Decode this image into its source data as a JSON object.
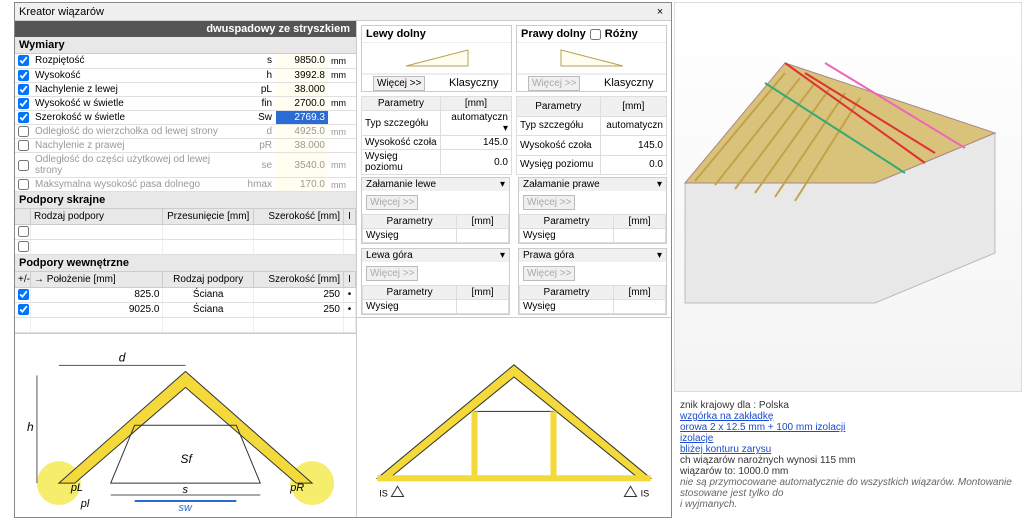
{
  "dialog": {
    "title": "Kreator wiązarów",
    "dark_header": "dwuspadowy ze stryszkiem"
  },
  "sections": {
    "wymiary": "Wymiary",
    "podpory_skrajne": "Podpory skrajne",
    "podpory_wewnetrzne": "Podpory wewnętrzne"
  },
  "params": [
    {
      "c": true,
      "label": "Rozpiętość",
      "sym": "s",
      "val": "9850.0",
      "unit": "mm",
      "sel": false
    },
    {
      "c": true,
      "label": "Wysokość",
      "sym": "h",
      "val": "3992.8",
      "unit": "mm",
      "sel": false
    },
    {
      "c": true,
      "label": "Nachylenie z lewej",
      "sym": "pL",
      "val": "38.000",
      "unit": "",
      "sel": false
    },
    {
      "c": true,
      "label": "Wysokość w świetle",
      "sym": "fin",
      "val": "2700.0",
      "unit": "mm",
      "sel": false
    },
    {
      "c": true,
      "label": "Szerokość w świetle",
      "sym": "Sw",
      "val": "2769.3",
      "unit": "",
      "sel": true
    },
    {
      "c": false,
      "label": "Odległość do wierzchołka od lewej strony",
      "sym": "d",
      "val": "4925.0",
      "unit": "mm",
      "sel": false,
      "dis": true
    },
    {
      "c": false,
      "label": "Nachylenie z prawej",
      "sym": "pR",
      "val": "38.000",
      "unit": "",
      "sel": false,
      "dis": true
    },
    {
      "c": false,
      "label": "Odległość do części użytkowej od lewej strony",
      "sym": "se",
      "val": "3540.0",
      "unit": "mm",
      "sel": false,
      "dis": true
    },
    {
      "c": false,
      "label": "Maksymalna wysokość pasa dolnego",
      "sym": "hmax",
      "val": "170.0",
      "unit": "mm",
      "sel": false,
      "dis": true
    }
  ],
  "ext_support_headers": {
    "c1": "Rodzaj podpory",
    "c2": "Przesunięcie [mm]",
    "c3": "Szerokość [mm]",
    "c4": "I"
  },
  "int_support_headers": {
    "c0": "+/-",
    "c1": "→ Położenie [mm]",
    "c2": "Rodzaj podpory",
    "c3": "Szerokość [mm]",
    "c4": "I"
  },
  "int_supports": [
    {
      "c": true,
      "pos": "825.0",
      "type": "Ściana",
      "w": "250",
      "m": "•"
    },
    {
      "c": true,
      "pos": "9025.0",
      "type": "Ściana",
      "w": "250",
      "m": "•"
    }
  ],
  "heel": {
    "left_title": "Lewy dolny",
    "right_title": "Prawy dolny",
    "rozny": "Różny",
    "more": "Więcej >>",
    "klasyczny": "Klasyczny",
    "p_param": "Parametry",
    "p_mm": "[mm]",
    "typ": "Typ szczegółu",
    "typ_val": "automatyczn",
    "wys": "Wysokość czoła",
    "wys_val": "145.0",
    "wysieg": "Wysięg poziomu",
    "wysieg_val": "0.0"
  },
  "groups": {
    "zal_l": "Załamanie lewe",
    "zal_r": "Załamanie prawe",
    "lg": "Lewa góra",
    "pg": "Prawa góra",
    "wysieg": "Wysięg"
  },
  "info": {
    "l1": "znik krajowy dla : Polska",
    "l2": "wzgórka na zakładkę",
    "l3": "orowa 2 x 12.5 mm + 100 mm izolacji",
    "l4": "izolacje",
    "l5": "bliżej konturu zarysu",
    "l6": "ch wiązarów narożnych wynosi 115 mm",
    "l7": "wiązarów to: 1000.0 mm",
    "l8": "nie są przymocowane automatycznie do wszystkich wiązarów. Montowanie stosowane jest tylko do",
    "l9": "i wyjmanych."
  }
}
